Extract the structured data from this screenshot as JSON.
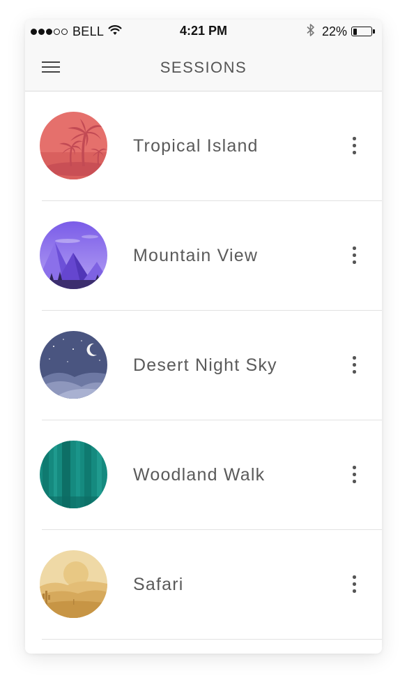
{
  "status_bar": {
    "carrier": "BELL",
    "signal_bars_filled": 3,
    "signal_bars_total": 5,
    "time": "4:21 PM",
    "battery_percent_label": "22%",
    "battery_level": 0.22
  },
  "header": {
    "title": "SESSIONS",
    "menu_icon": "hamburger-menu-icon"
  },
  "sessions": [
    {
      "label": "Tropical Island",
      "thumbnail": "tropical-island-thumbnail",
      "more_icon": "more-vertical-icon",
      "color": "#e06a6a"
    },
    {
      "label": "Mountain View",
      "thumbnail": "mountain-view-thumbnail",
      "more_icon": "more-vertical-icon",
      "color": "#7b5ee6"
    },
    {
      "label": "Desert Night Sky",
      "thumbnail": "desert-night-sky-thumbnail",
      "more_icon": "more-vertical-icon",
      "color": "#4e5a82"
    },
    {
      "label": "Woodland Walk",
      "thumbnail": "woodland-walk-thumbnail",
      "more_icon": "more-vertical-icon",
      "color": "#17887d"
    },
    {
      "label": "Safari",
      "thumbnail": "safari-thumbnail",
      "more_icon": "more-vertical-icon",
      "color": "#d9b060"
    }
  ]
}
